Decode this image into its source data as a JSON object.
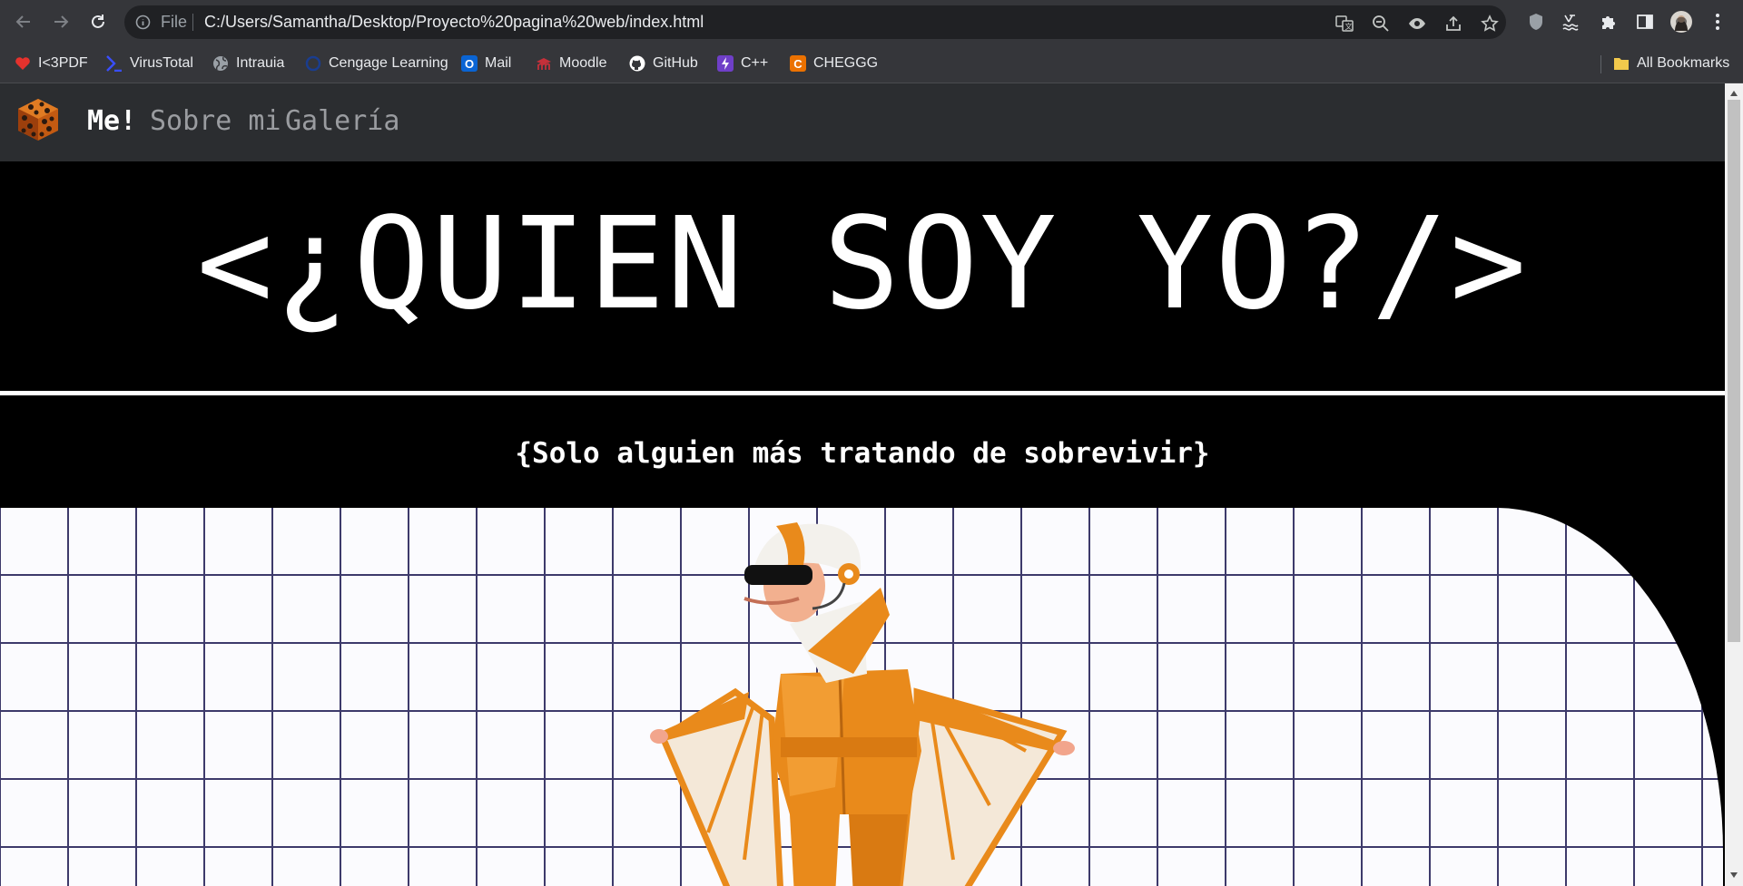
{
  "browser": {
    "scheme_label": "File",
    "url": "C:/Users/Samantha/Desktop/Proyecto%20pagina%20web/index.html",
    "bookmarks": [
      {
        "label": "I<3PDF",
        "icon": "heart-pdf-icon",
        "color": "#e5322d"
      },
      {
        "label": "VirusTotal",
        "icon": "virustotal-icon",
        "color": "#394eff"
      },
      {
        "label": "Intrauia",
        "icon": "globe-icon",
        "color": "#9aa0a6"
      },
      {
        "label": "Cengage Learning",
        "icon": "cengage-icon",
        "color": "#1a3d8f"
      },
      {
        "label": "Mail",
        "icon": "outlook-icon",
        "color": "#0a64d3"
      },
      {
        "label": "Moodle",
        "icon": "moodle-icon",
        "color": "#c5303a"
      },
      {
        "label": "GitHub",
        "icon": "github-icon",
        "color": "#ffffff"
      },
      {
        "label": "C++",
        "icon": "cpp-icon",
        "color": "#6f3fc8"
      },
      {
        "label": "CHEGGG",
        "icon": "chegg-icon",
        "color": "#eb7100"
      }
    ],
    "all_bookmarks_label": "All Bookmarks"
  },
  "page": {
    "brand": "Me!",
    "nav_links": [
      "Sobre mi",
      "Galería"
    ],
    "hero_title": "<¿QUIEN SOY YO?/>",
    "subtitle": "{Solo alguien más tratando de sobrevivir}"
  },
  "colors": {
    "chrome_bg": "#35363a",
    "omnibox_bg": "#202124",
    "navbar_bg": "#2b2d30",
    "page_bg": "#000000",
    "grid_line": "#3d3a6b",
    "character_orange": "#e98a1b"
  }
}
